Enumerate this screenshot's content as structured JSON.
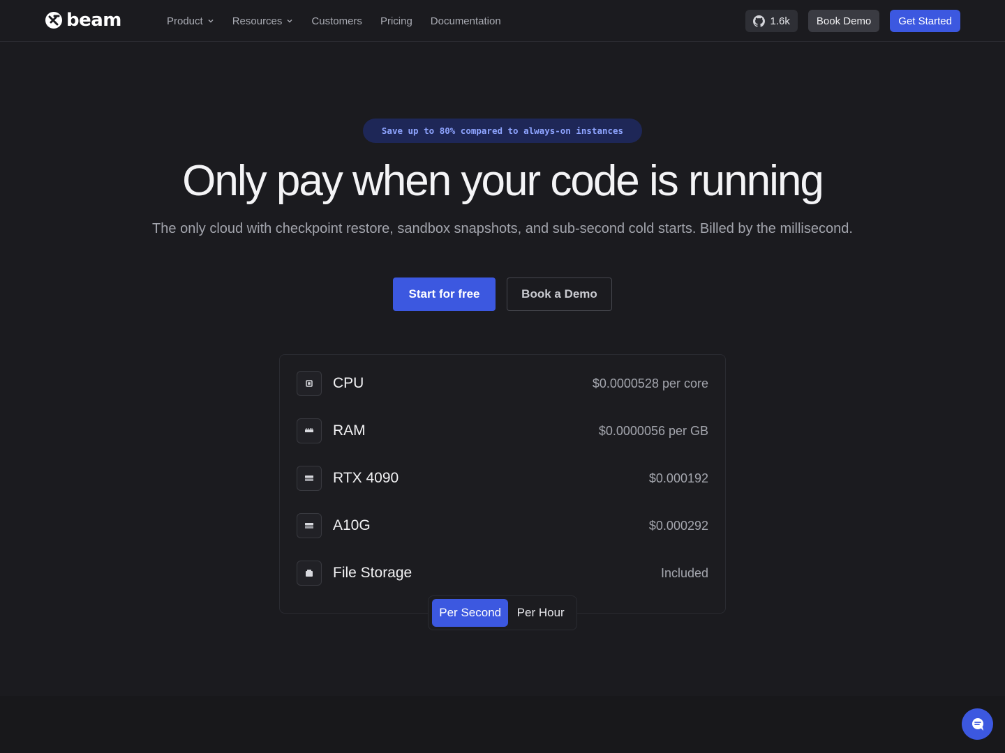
{
  "brand": {
    "name": "beam"
  },
  "nav": {
    "links": [
      {
        "label": "Product",
        "dropdown": true
      },
      {
        "label": "Resources",
        "dropdown": true
      },
      {
        "label": "Customers",
        "dropdown": false
      },
      {
        "label": "Pricing",
        "dropdown": false
      },
      {
        "label": "Documentation",
        "dropdown": false
      }
    ],
    "github_stars": "1.6k",
    "book_demo": "Book Demo",
    "get_started": "Get Started"
  },
  "hero": {
    "badge": "Save up to 80% compared to always-on instances",
    "title": "Only pay when your code is running",
    "subtitle": "The only cloud with checkpoint restore, sandbox snapshots, and sub-second cold starts. Billed by the millisecond.",
    "cta_primary": "Start for free",
    "cta_secondary": "Book a Demo"
  },
  "pricing": {
    "rows": [
      {
        "icon": "cpu-icon",
        "name": "CPU",
        "price": "$0.0000528 per core"
      },
      {
        "icon": "ram-icon",
        "name": "RAM",
        "price": "$0.0000056 per GB"
      },
      {
        "icon": "gpu-icon",
        "name": "RTX 4090",
        "price": "$0.000192"
      },
      {
        "icon": "gpu-icon",
        "name": "A10G",
        "price": "$0.000292"
      },
      {
        "icon": "storage-icon",
        "name": "File Storage",
        "price": "Included"
      }
    ],
    "toggle": {
      "options": [
        "Per Second",
        "Per Hour"
      ],
      "selected": "Per Second"
    }
  },
  "colors": {
    "accent": "#3c58e0",
    "background": "#1b1b1f",
    "badge_text": "#8ea4ff"
  }
}
